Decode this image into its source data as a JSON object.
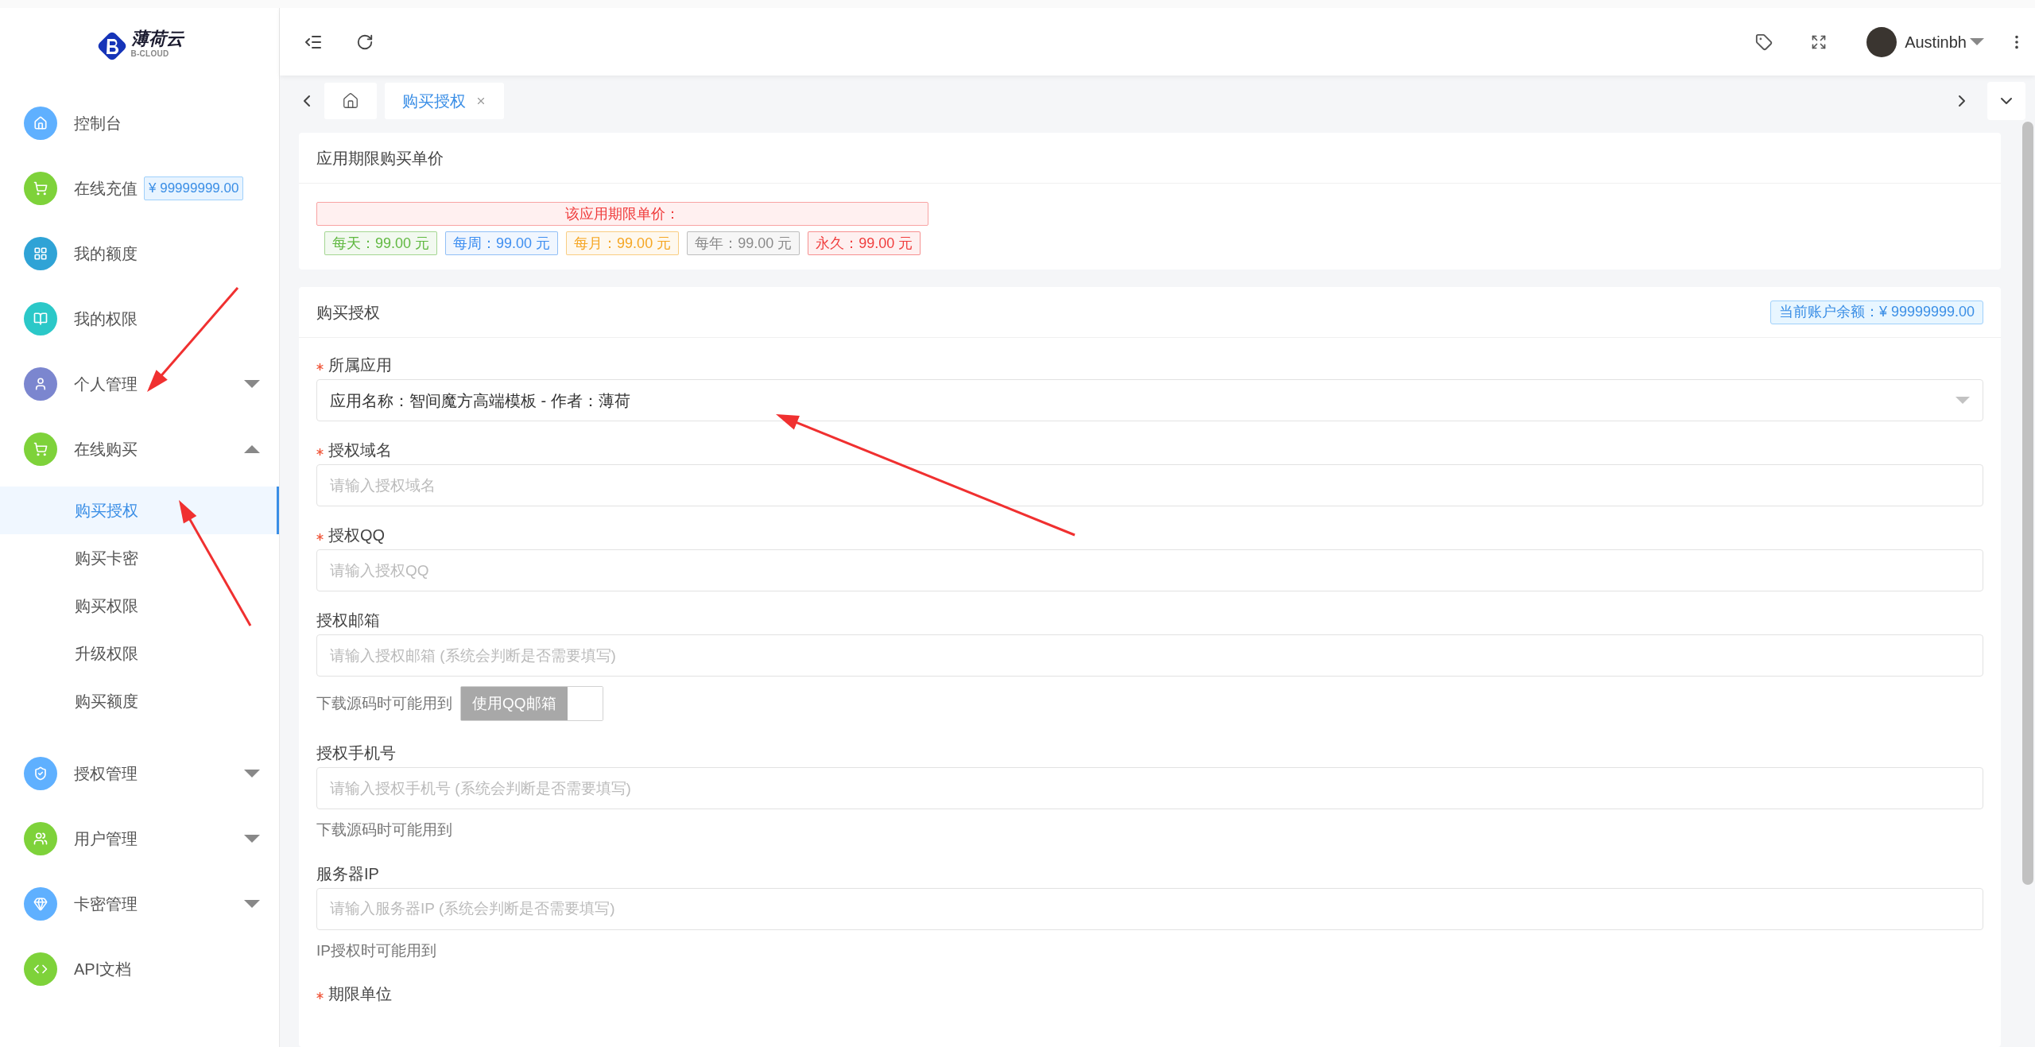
{
  "logo": {
    "name": "薄荷云",
    "subtitle": "B-CLOUD"
  },
  "sidebar": {
    "items": [
      {
        "label": "控制台",
        "color": "#5fb0ff"
      },
      {
        "label": "在线充值",
        "color": "#7ed23a",
        "badge": "¥ 99999999.00"
      },
      {
        "label": "我的额度",
        "color": "#2fa3d6"
      },
      {
        "label": "我的权限",
        "color": "#2bc8c8"
      },
      {
        "label": "个人管理",
        "color": "#7b86cf",
        "expanded": false
      },
      {
        "label": "在线购买",
        "color": "#7ed23a",
        "expanded": true,
        "children": [
          {
            "label": "购买授权",
            "selected": true
          },
          {
            "label": "购买卡密",
            "selected": false
          },
          {
            "label": "购买权限",
            "selected": false
          },
          {
            "label": "升级权限",
            "selected": false
          },
          {
            "label": "购买额度",
            "selected": false
          }
        ]
      },
      {
        "label": "授权管理",
        "color": "#5fb0ff",
        "expanded": false
      },
      {
        "label": "用户管理",
        "color": "#7ed23a",
        "expanded": false
      },
      {
        "label": "卡密管理",
        "color": "#5fb0ff",
        "expanded": false
      },
      {
        "label": "API文档",
        "color": "#7ed23a"
      }
    ]
  },
  "header": {
    "user": "Austinbh"
  },
  "tabs": [
    {
      "kind": "home",
      "selected": false
    },
    {
      "kind": "page",
      "label": "购买授权",
      "selected": true
    }
  ],
  "price_card": {
    "title": "应用期限购买单价",
    "notice": "该应用期限单价：",
    "prices": [
      {
        "label": "每天：99.00 元",
        "color": "#5fb840"
      },
      {
        "label": "每周：99.00 元",
        "color": "#3d8ef0"
      },
      {
        "label": "每月：99.00 元",
        "color": "#f5a623"
      },
      {
        "label": "每年：99.00 元",
        "color": "#8a8a8a"
      },
      {
        "label": "永久：99.00 元",
        "color": "#f03c3c"
      }
    ]
  },
  "form": {
    "title": "购买授权",
    "balance": "当前账户余额：¥ 99999999.00",
    "fields": [
      {
        "kind": "select",
        "label": "所属应用",
        "required": true,
        "value": "应用名称：智间魔方高端模板 - 作者：薄荷"
      },
      {
        "kind": "input",
        "label": "授权域名",
        "required": true,
        "placeholder": "请输入授权域名"
      },
      {
        "kind": "input",
        "label": "授权QQ",
        "required": true,
        "placeholder": "请输入授权QQ"
      },
      {
        "kind": "input",
        "label": "授权邮箱",
        "required": false,
        "placeholder": "请输入授权邮箱 (系统会判断是否需要填写)",
        "help": "下载源码时可能用到",
        "checkbox": {
          "label": "使用QQ邮箱",
          "checked": false
        }
      },
      {
        "kind": "input",
        "label": "授权手机号",
        "required": false,
        "placeholder": "请输入授权手机号 (系统会判断是否需要填写)",
        "help": "下载源码时可能用到"
      },
      {
        "kind": "input",
        "label": "服务器IP",
        "required": false,
        "placeholder": "请输入服务器IP (系统会判断是否需要填写)",
        "help": "IP授权时可能用到"
      },
      {
        "kind": "label",
        "label": "期限单位",
        "required": true
      }
    ]
  }
}
